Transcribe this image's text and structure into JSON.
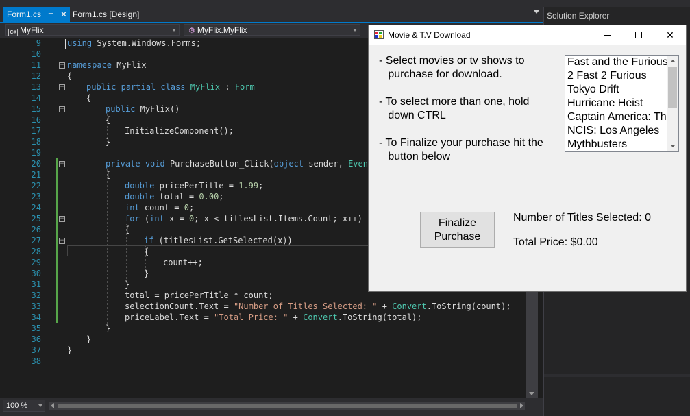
{
  "ide": {
    "tabs": [
      {
        "label": "Form1.cs",
        "pin": "⊣",
        "close": "✕"
      },
      {
        "label": "Form1.cs [Design]"
      }
    ],
    "nav": {
      "project_icon": "C#",
      "project": "MyFlix",
      "member": "MyFlix.MyFlix"
    },
    "zoom": "100 %",
    "solution_explorer": {
      "title": "Solution Explorer"
    },
    "line_numbers": [
      "9",
      "10",
      "11",
      "12",
      "13",
      "14",
      "15",
      "16",
      "17",
      "18",
      "19",
      "20",
      "21",
      "22",
      "23",
      "24",
      "25",
      "26",
      "27",
      "28",
      "29",
      "30",
      "31",
      "32",
      "33",
      "34",
      "35",
      "36",
      "37",
      "38"
    ],
    "code": {
      "l9": {
        "kw": "using",
        "rest": " System.Windows.Forms;"
      },
      "l11": {
        "kw": "namespace",
        "rest": " MyFlix"
      },
      "l12": "{",
      "l13": {
        "kw1": "public",
        "kw2": "partial",
        "kw3": "class",
        "name": "MyFlix",
        "colon": " : ",
        "base": "Form"
      },
      "l14": "{",
      "l15": {
        "kw": "public",
        "rest": " MyFlix()"
      },
      "l16": "{",
      "l17": "InitializeComponent();",
      "l18": "}",
      "l20": {
        "kw1": "private",
        "kw2": "void",
        "rest": " PurchaseButton_Click(",
        "kw3": "object",
        "rest2": " sender, ",
        "ty": "EventA"
      },
      "l21": "{",
      "l22": {
        "kw": "double",
        "rest": " pricePerTitle = ",
        "num": "1.99",
        "end": ";"
      },
      "l23": {
        "kw": "double",
        "rest": " total = ",
        "num": "0.00",
        "end": ";"
      },
      "l24": {
        "kw": "int",
        "rest": " count = ",
        "num": "0",
        "end": ";"
      },
      "l25": {
        "kw1": "for",
        "p1": " (",
        "kw2": "int",
        "rest": " x = ",
        "num": "0",
        "rest2": "; x < titlesList.Items.Count; x++)"
      },
      "l26": "{",
      "l27": {
        "kw": "if",
        "rest": " (titlesList.GetSelected(x))"
      },
      "l28": "{",
      "l29": "count++;",
      "l30": "}",
      "l31": "}",
      "l32": "total = pricePerTitle * count;",
      "l33": {
        "pre": "selectionCount.Text = ",
        "str": "\"Number of Titles Selected: \"",
        "mid": " + ",
        "ty": "Convert",
        "post": ".ToString(count);"
      },
      "l34": {
        "pre": "priceLabel.Text = ",
        "str": "\"Total Price: \"",
        "mid": " + ",
        "ty": "Convert",
        "post": ".ToString(total);"
      },
      "l35": "}",
      "l36": "}",
      "l37": "}"
    }
  },
  "app": {
    "title": "Movie & T.V Download",
    "controls": {
      "minimize": "minimize",
      "maximize": "maximize",
      "close": "✕"
    },
    "instructions": [
      "- Select movies or tv shows to\n   purchase for download.",
      "- To select more than one, hold\n   down CTRL",
      "- To Finalize your purchase hit the\n   button below"
    ],
    "titles": [
      "Fast and the Furious",
      "2 Fast 2 Furious",
      "Tokyo Drift",
      "Hurricane Heist",
      "Captain America: The",
      "NCIS: Los Angeles",
      "Mythbusters"
    ],
    "finalize_button": "Finalize\nPurchase",
    "selection_count": "Number of Titles Selected: 0",
    "total_price": "Total Price: $0.00"
  }
}
